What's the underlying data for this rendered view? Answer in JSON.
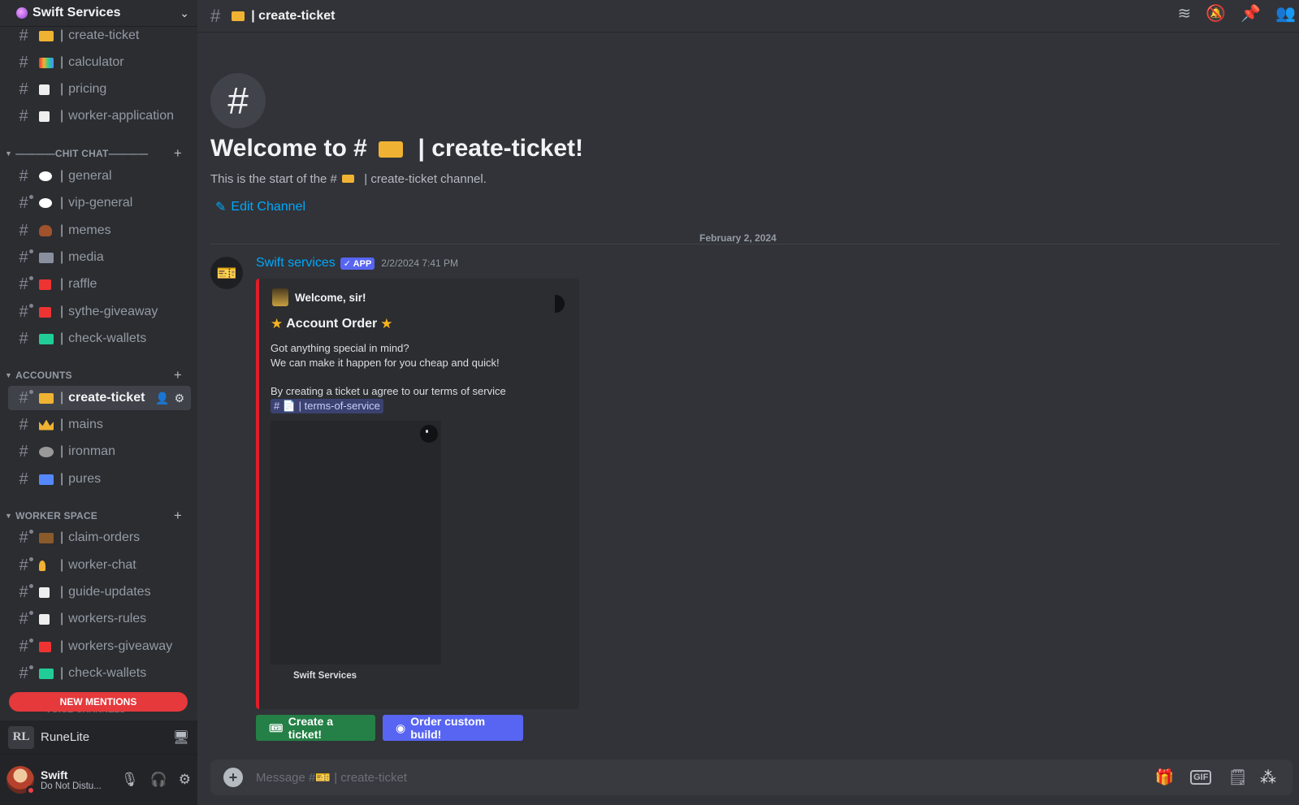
{
  "server": {
    "name": "Swift Services"
  },
  "sidebar": {
    "channels_top": [
      {
        "emoji": "🎫",
        "name": "create-ticket",
        "color": "#f0b232"
      },
      {
        "emoji": "🧮",
        "name": "calculator",
        "color": "#d33"
      },
      {
        "emoji": "📝",
        "name": "pricing",
        "color": "#e8e8e8"
      },
      {
        "emoji": "📝",
        "name": "worker-application",
        "color": "#e8e8e8"
      }
    ],
    "cat_chitchat": "————CHIT CHAT————",
    "channels_chitchat": [
      {
        "emoji": "💬",
        "name": "general",
        "color": "#ffffff"
      },
      {
        "emoji": "💬",
        "name": "vip-general",
        "color": "#ffffff"
      },
      {
        "emoji": "💩",
        "name": "memes",
        "color": "#a0522d"
      },
      {
        "emoji": "📷",
        "name": "media",
        "color": "#aab"
      },
      {
        "emoji": "🎁",
        "name": "raffle",
        "color": "#e33"
      },
      {
        "emoji": "🎁",
        "name": "sythe-giveaway",
        "color": "#e33"
      },
      {
        "emoji": "💵",
        "name": "check-wallets",
        "color": "#2c9"
      }
    ],
    "cat_accounts": "ACCOUNTS",
    "channels_accounts": [
      {
        "emoji": "🎫",
        "name": "create-ticket",
        "color": "#f0b232"
      },
      {
        "emoji": "👑",
        "name": "mains",
        "color": "#f0b232"
      },
      {
        "emoji": "💪",
        "name": "ironman",
        "color": "#999"
      },
      {
        "emoji": "🧑",
        "name": "pures",
        "color": "#58f"
      }
    ],
    "cat_worker": "WORKER SPACE",
    "channels_worker": [
      {
        "emoji": "💼",
        "name": "claim-orders",
        "color": "#8b5a2b"
      },
      {
        "emoji": "💡",
        "name": "worker-chat",
        "color": "#f0b232"
      },
      {
        "emoji": "📝",
        "name": "guide-updates",
        "color": "#e8e8e8"
      },
      {
        "emoji": "📝",
        "name": "workers-rules",
        "color": "#e8e8e8"
      },
      {
        "emoji": "🎁",
        "name": "workers-giveaway",
        "color": "#e33"
      },
      {
        "emoji": "💵",
        "name": "check-wallets",
        "color": "#2c9"
      }
    ],
    "new_mentions": "NEW MENTIONS",
    "voice_peek": "VOICE CHANNELS",
    "activity": {
      "icon_text": "RL",
      "name": "RuneLite"
    },
    "user": {
      "name": "Swift",
      "status": "Do Not Distu..."
    }
  },
  "header": {
    "channel": "| create-ticket"
  },
  "welcome": {
    "title_prefix": "Welcome to #",
    "title_suffix": "| create-ticket!",
    "subtitle_prefix": "This is the start of the #",
    "subtitle_suffix": "| create-ticket channel.",
    "edit_label": "Edit Channel"
  },
  "divider_date": "February 2, 2024",
  "message": {
    "author": "Swift services",
    "badge": "APP",
    "timestamp": "2/2/2024 7:41 PM",
    "embed": {
      "author": "Welcome, sir!",
      "title": "Account Order",
      "line1": "Got anything special in mind?",
      "line2": "We can make it happen for you cheap and quick!",
      "line3": "By creating a ticket u agree to our terms of service",
      "mention": "📄 | terms-of-service",
      "footer": "Swift Services",
      "accent": "#e11d2a"
    },
    "buttons": [
      {
        "label": "Create a ticket!",
        "color": "#248046"
      },
      {
        "label": "Order custom build!",
        "color": "#5865f2"
      }
    ]
  },
  "composer": {
    "placeholder": "Message #🎫 | create-ticket"
  }
}
